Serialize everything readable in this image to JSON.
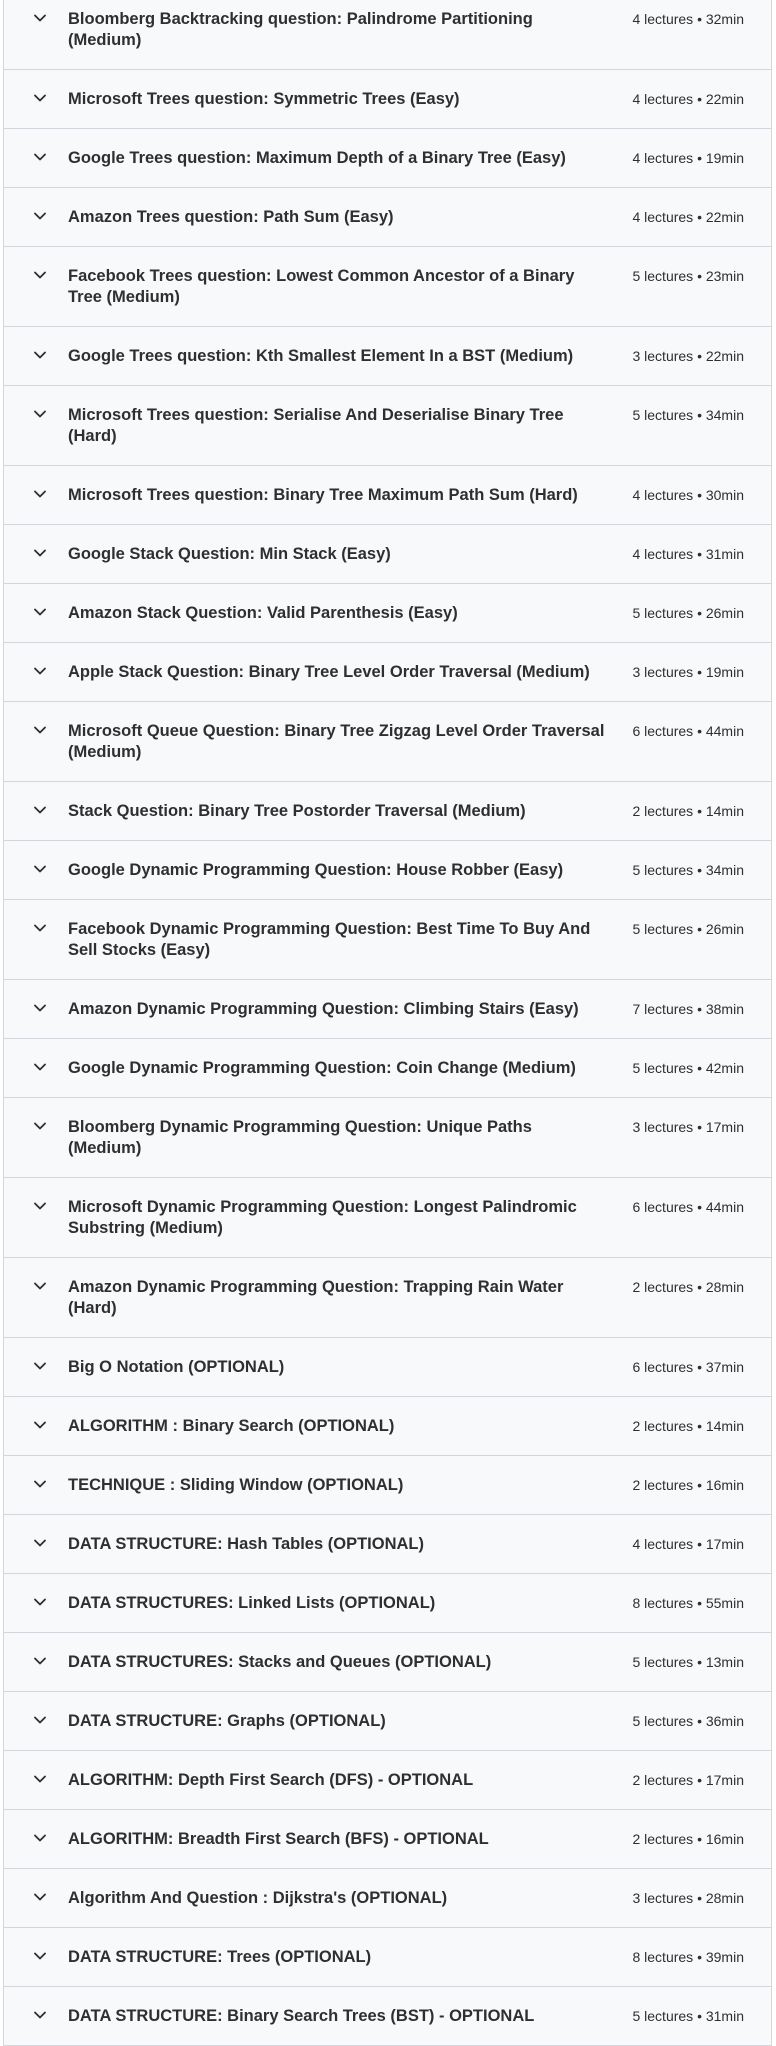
{
  "sections": [
    {
      "title": "Bloomberg Backtracking question: Palindrome Partitioning (Medium)",
      "meta": "4 lectures • 32min",
      "lines": 2
    },
    {
      "title": "Microsoft Trees question: Symmetric Trees (Easy)",
      "meta": "4 lectures • 22min",
      "lines": 1
    },
    {
      "title": "Google Trees question: Maximum Depth of a Binary Tree (Easy)",
      "meta": "4 lectures • 19min",
      "lines": 1
    },
    {
      "title": "Amazon Trees question: Path Sum (Easy)",
      "meta": "4 lectures • 22min",
      "lines": 1
    },
    {
      "title": "Facebook Trees question: Lowest Common Ancestor of a Binary Tree (Medium)",
      "meta": "5 lectures • 23min",
      "lines": 2
    },
    {
      "title": "Google Trees question: Kth Smallest Element In a BST (Medium)",
      "meta": "3 lectures • 22min",
      "lines": 1
    },
    {
      "title": "Microsoft Trees question: Serialise And Deserialise Binary Tree (Hard)",
      "meta": "5 lectures • 34min",
      "lines": 2
    },
    {
      "title": "Microsoft Trees question: Binary Tree Maximum Path Sum (Hard)",
      "meta": "4 lectures • 30min",
      "lines": 1
    },
    {
      "title": "Google Stack Question: Min Stack (Easy)",
      "meta": "4 lectures • 31min",
      "lines": 1
    },
    {
      "title": "Amazon Stack Question: Valid Parenthesis (Easy)",
      "meta": "5 lectures • 26min",
      "lines": 1
    },
    {
      "title": "Apple Stack Question: Binary Tree Level Order Traversal (Medium)",
      "meta": "3 lectures • 19min",
      "lines": 1
    },
    {
      "title": "Microsoft Queue Question: Binary Tree Zigzag Level Order Traversal (Medium)",
      "meta": "6 lectures • 44min",
      "lines": 2
    },
    {
      "title": "Stack Question: Binary Tree Postorder Traversal (Medium)",
      "meta": "2 lectures • 14min",
      "lines": 1
    },
    {
      "title": "Google Dynamic Programming Question: House Robber (Easy)",
      "meta": "5 lectures • 34min",
      "lines": 1
    },
    {
      "title": "Facebook Dynamic Programming Question: Best Time To Buy And Sell Stocks (Easy)",
      "meta": "5 lectures • 26min",
      "lines": 2
    },
    {
      "title": "Amazon Dynamic Programming Question: Climbing Stairs (Easy)",
      "meta": "7 lectures • 38min",
      "lines": 1
    },
    {
      "title": "Google Dynamic Programming Question: Coin Change (Medium)",
      "meta": "5 lectures • 42min",
      "lines": 1
    },
    {
      "title": "Bloomberg Dynamic Programming Question: Unique Paths (Medium)",
      "meta": "3 lectures • 17min",
      "lines": 2
    },
    {
      "title": "Microsoft Dynamic Programming Question: Longest Palindromic Substring (Medium)",
      "meta": "6 lectures • 44min",
      "lines": 2
    },
    {
      "title": "Amazon Dynamic Programming Question: Trapping Rain Water (Hard)",
      "meta": "2 lectures • 28min",
      "lines": 2
    },
    {
      "title": "Big O Notation (OPTIONAL)",
      "meta": "6 lectures • 37min",
      "lines": 1
    },
    {
      "title": "ALGORITHM : Binary Search (OPTIONAL)",
      "meta": "2 lectures • 14min",
      "lines": 1
    },
    {
      "title": "TECHNIQUE : Sliding Window (OPTIONAL)",
      "meta": "2 lectures • 16min",
      "lines": 1
    },
    {
      "title": "DATA STRUCTURE: Hash Tables (OPTIONAL)",
      "meta": "4 lectures • 17min",
      "lines": 1
    },
    {
      "title": "DATA STRUCTURES: Linked Lists (OPTIONAL)",
      "meta": "8 lectures • 55min",
      "lines": 1
    },
    {
      "title": "DATA STRUCTURES: Stacks and Queues (OPTIONAL)",
      "meta": "5 lectures • 13min",
      "lines": 1
    },
    {
      "title": "DATA STRUCTURE: Graphs (OPTIONAL)",
      "meta": "5 lectures • 36min",
      "lines": 1
    },
    {
      "title": "ALGORITHM: Depth First Search (DFS) - OPTIONAL",
      "meta": "2 lectures • 17min",
      "lines": 1
    },
    {
      "title": "ALGORITHM: Breadth First Search (BFS) - OPTIONAL",
      "meta": "2 lectures • 16min",
      "lines": 1
    },
    {
      "title": "Algorithm And Question : Dijkstra's (OPTIONAL)",
      "meta": "3 lectures • 28min",
      "lines": 1
    },
    {
      "title": "DATA STRUCTURE: Trees (OPTIONAL)",
      "meta": "8 lectures • 39min",
      "lines": 1
    },
    {
      "title": "DATA STRUCTURE: Binary Search Trees (BST) - OPTIONAL",
      "meta": "5 lectures • 31min",
      "lines": 1
    }
  ],
  "icons": {
    "expand": "chevron-down-icon"
  },
  "colors": {
    "row_background": "#f7f9fa",
    "border": "#d1d7dc",
    "text": "#2d2f31"
  }
}
